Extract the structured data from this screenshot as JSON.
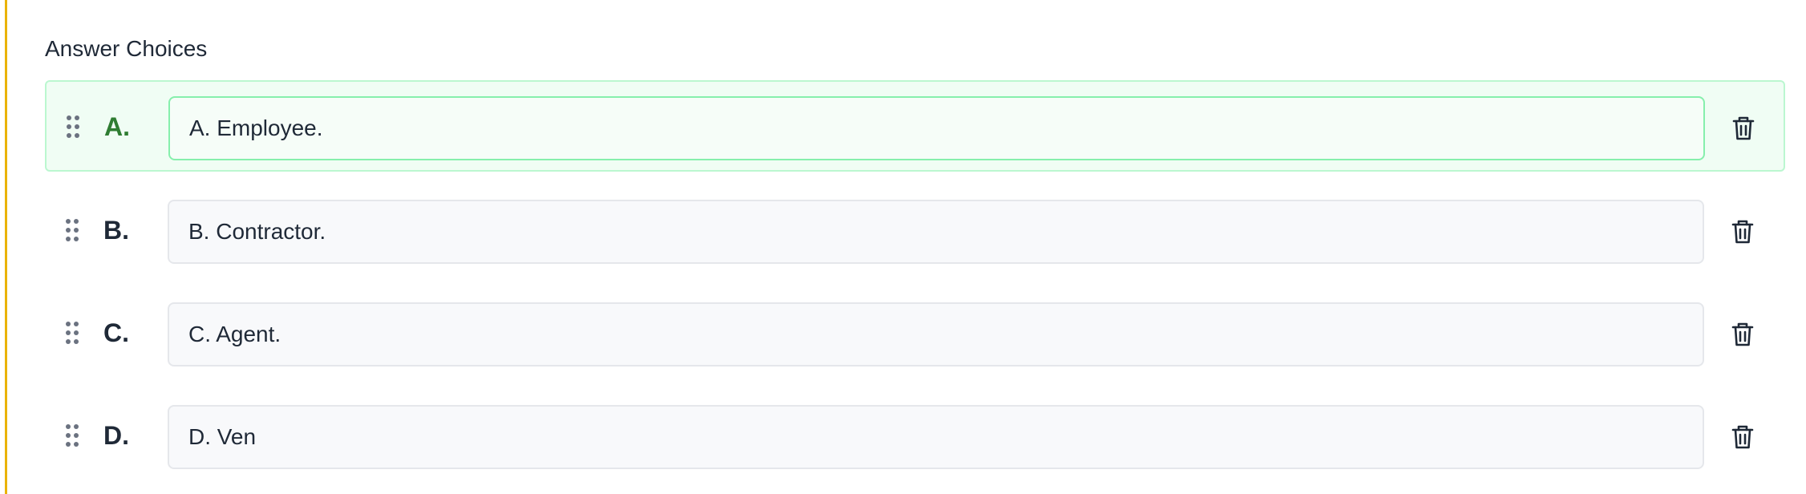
{
  "section": {
    "title": "Answer Choices"
  },
  "choices": [
    {
      "letter": "A.",
      "value": "A. Employee.",
      "correct": true
    },
    {
      "letter": "B.",
      "value": "B. Contractor.",
      "correct": false
    },
    {
      "letter": "C.",
      "value": "C. Agent.",
      "correct": false
    },
    {
      "letter": "D.",
      "value": "D. Ven",
      "correct": false
    }
  ],
  "colors": {
    "accent_bar": "#eab308",
    "correct_letter": "#2f7d32",
    "correct_bg": "#f0fdf4",
    "correct_border": "#bbf7d0"
  },
  "icons": {
    "drag": "drag-handle-icon",
    "delete": "trash-icon"
  }
}
